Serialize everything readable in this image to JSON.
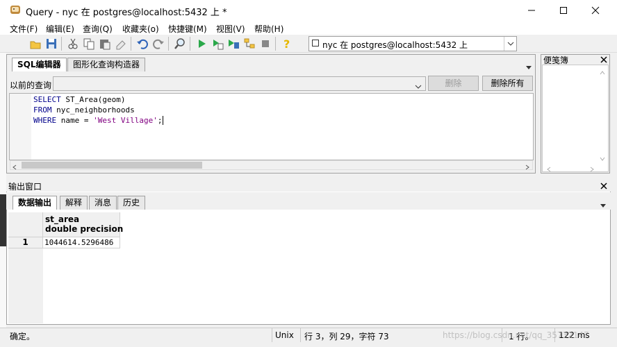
{
  "window": {
    "title": "Query - nyc 在  postgres@localhost:5432 上 *"
  },
  "menu": [
    "文件(F)",
    "编辑(E)",
    "查询(Q)",
    "收藏夹(o)",
    "快捷键(M)",
    "视图(V)",
    "帮助(H)"
  ],
  "toolbar": {
    "connection": "nyc 在  postgres@localhost:5432 上"
  },
  "sql_editor": {
    "tabs": [
      "SQL编辑器",
      "图形化查询构造器"
    ],
    "history_label": "以前的查询",
    "delete_label": "删除",
    "delete_all_label": "删除所有",
    "code": {
      "line1_kw": "SELECT",
      "line1_rest": " ST_Area(geom)",
      "line2_kw": "FROM",
      "line2_rest": " nyc_neighborhoods",
      "line3_kw": "WHERE",
      "line3_mid": " name = ",
      "line3_str": "'West Village'",
      "line3_end": ";"
    }
  },
  "scratch_pad": {
    "title": "便笺簿"
  },
  "output": {
    "title": "输出窗口",
    "tabs": [
      "数据输出",
      "解释",
      "消息",
      "历史"
    ],
    "columns": [
      {
        "name": "st_area",
        "type": "double precision"
      }
    ],
    "rows": [
      {
        "row_num": "1",
        "value": "1044614.5296486"
      }
    ]
  },
  "status": {
    "message": "确定。",
    "line_ending": "Unix",
    "position": "行 3，列 29，字符 73",
    "rows": "1 行。",
    "time": "122 ms"
  },
  "watermark": "https://blog.csdn.net/qq_35732147"
}
